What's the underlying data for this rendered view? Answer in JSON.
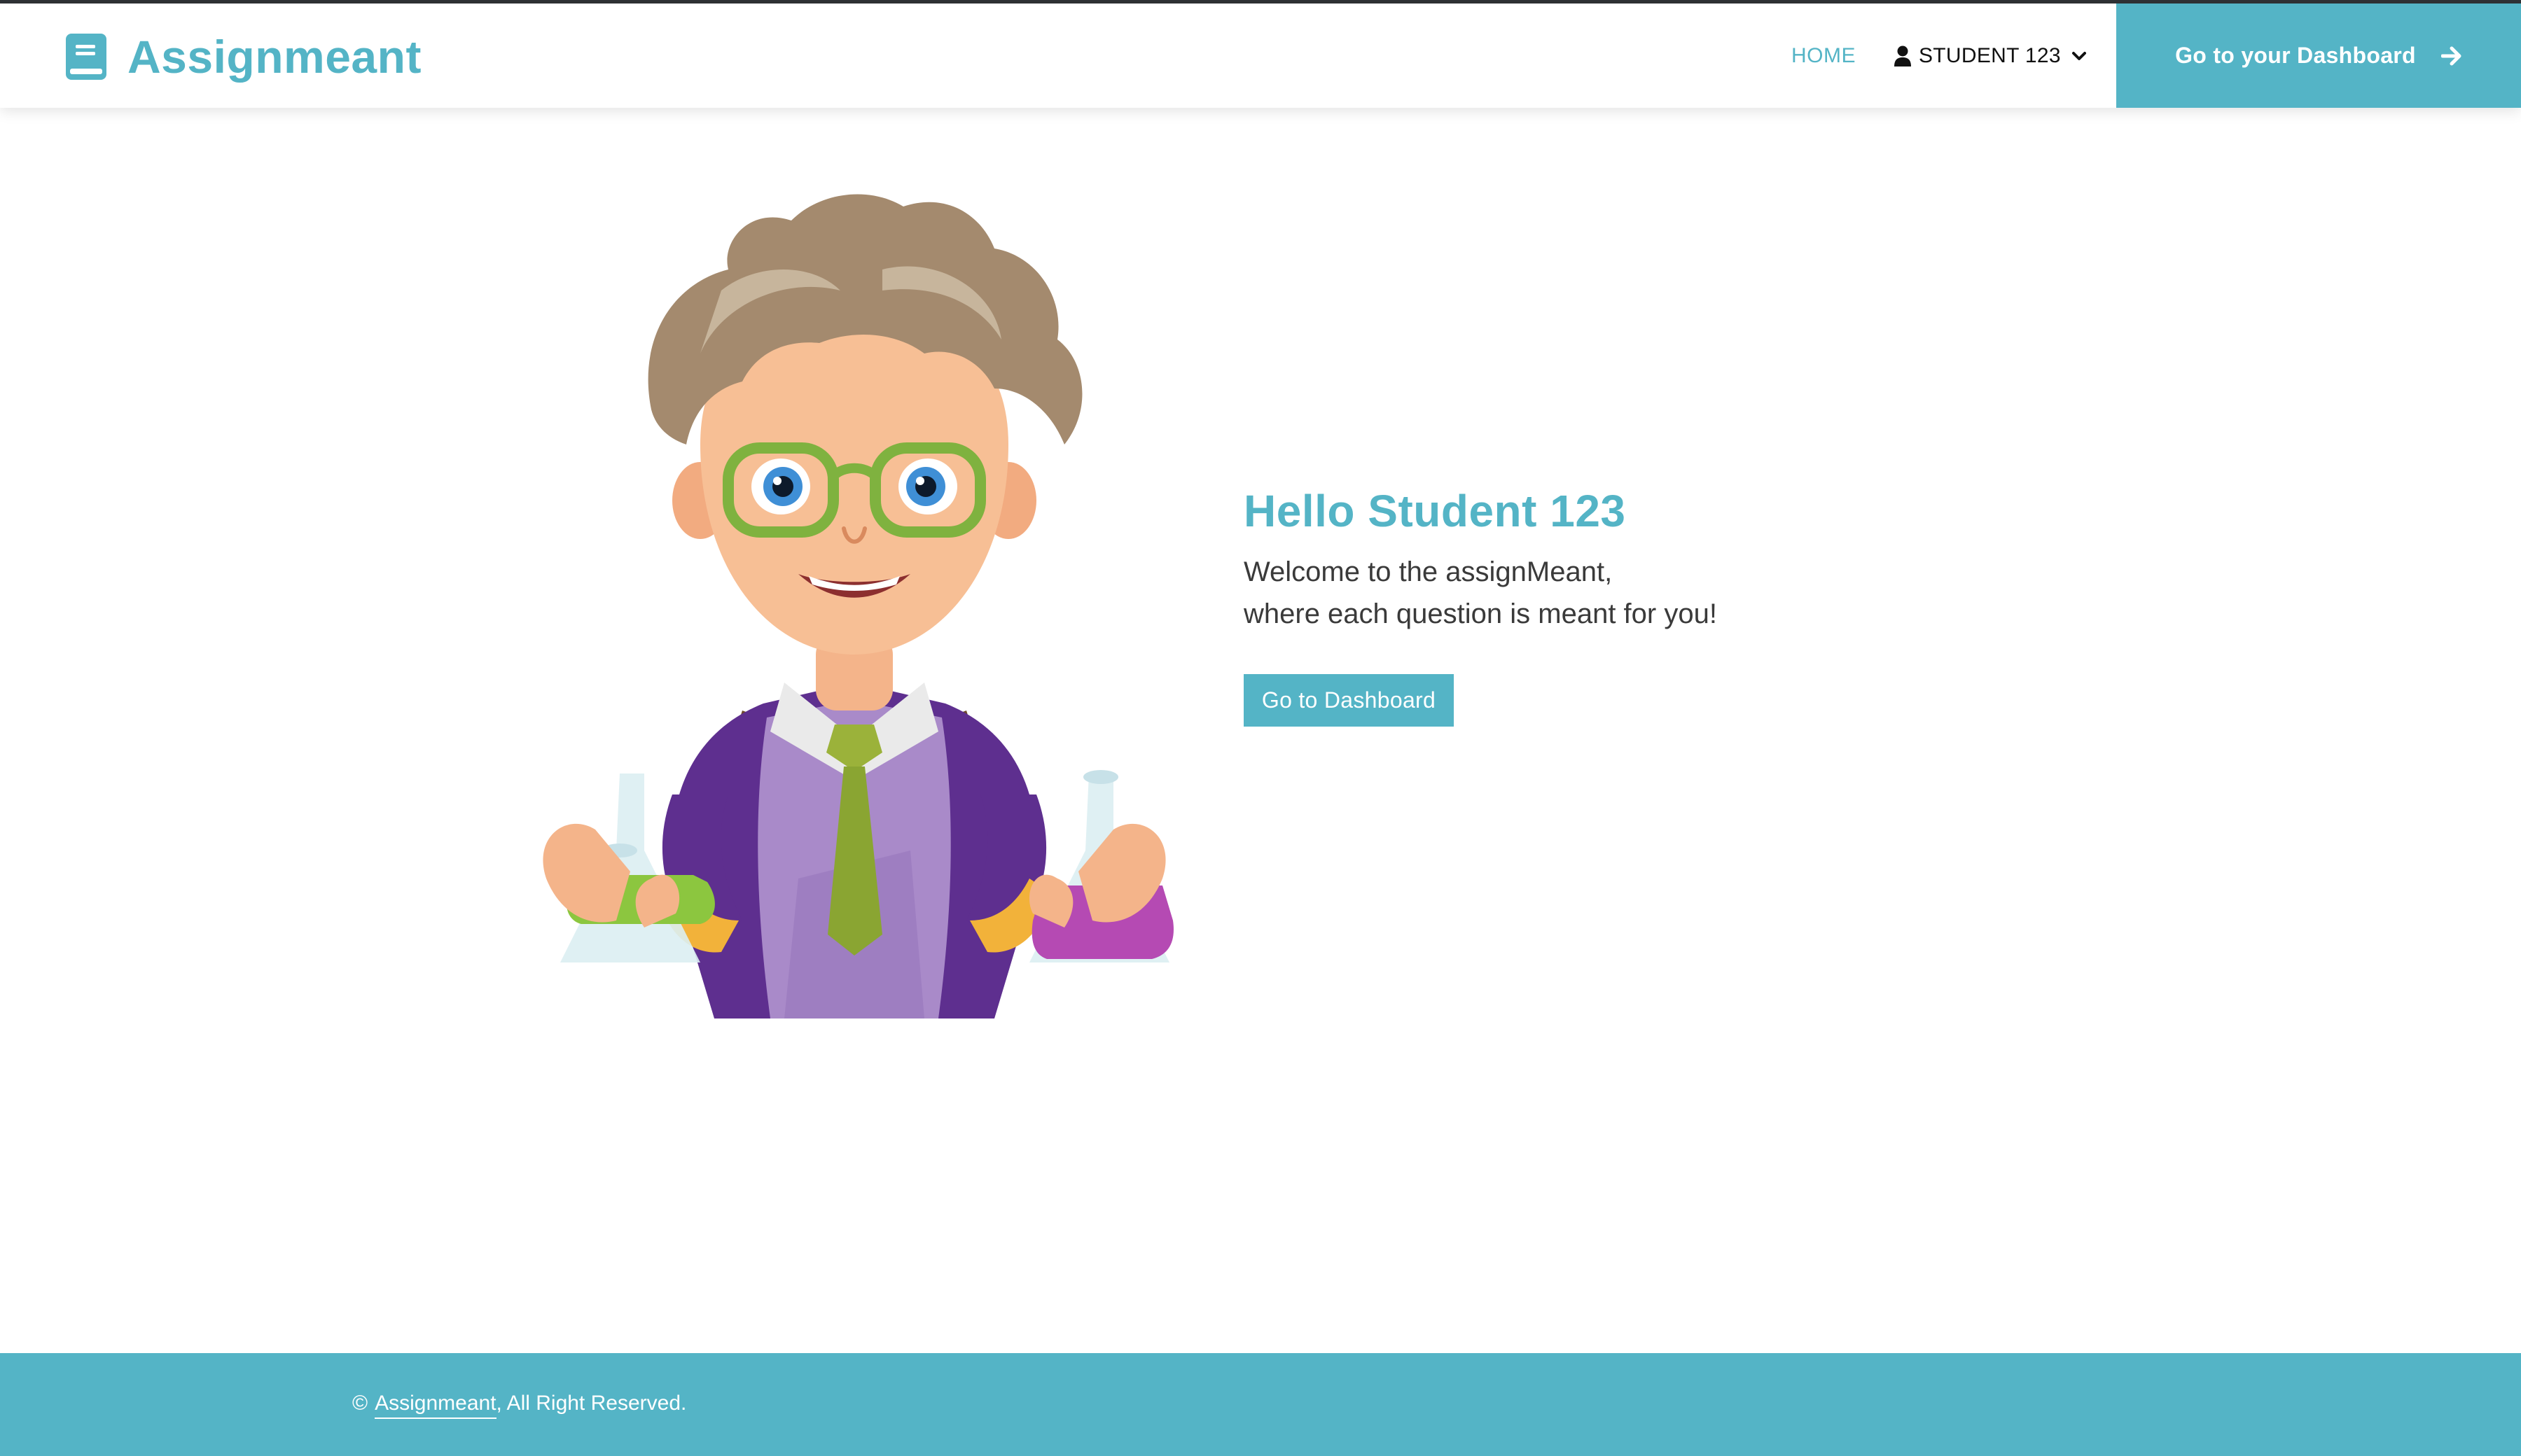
{
  "colors": {
    "accent": "#54b4c6",
    "text_dark": "#3a3a3a",
    "nav_text": "#111111",
    "background": "#ffffff"
  },
  "header": {
    "brand_icon": "book-icon",
    "brand_name": "Assignmeant",
    "nav": {
      "home_label": "HOME",
      "user_icon": "user-icon",
      "user_label": "STUDENT 123",
      "user_chevron_icon": "chevron-down-icon"
    },
    "cta": {
      "label": "Go to your Dashboard",
      "icon": "arrow-right-icon"
    }
  },
  "hero": {
    "illustration": "student-scientist-with-flasks",
    "title": "Hello Student 123",
    "line1": "Welcome to the assignMeant,",
    "line2": "where each question is meant for you!",
    "button_label": "Go to Dashboard"
  },
  "footer": {
    "copyright_symbol": "©",
    "link_text": "Assignmeant",
    "suffix": ", All Right Reserved."
  }
}
